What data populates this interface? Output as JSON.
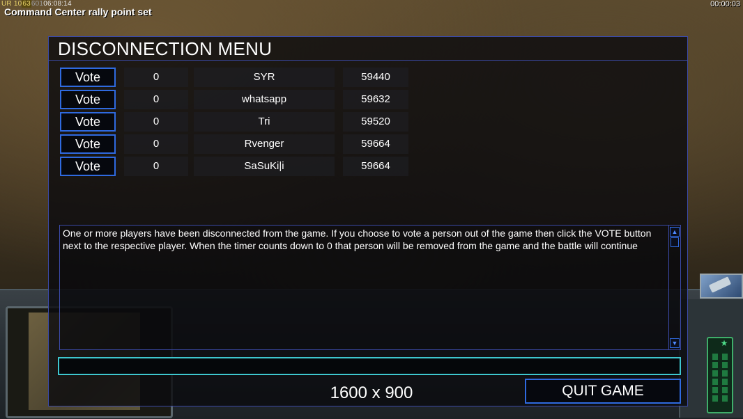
{
  "hud": {
    "stats_ur": "UR 10",
    "stats_63": "63",
    "stats_601": "601",
    "stats_time": "06:08:14",
    "notification": "Command Center rally point set",
    "game_timer": "00:00:03"
  },
  "dialog": {
    "title": "DISCONNECTION MENU",
    "vote_label": "Vote",
    "players": [
      {
        "count": "0",
        "name": "SYR",
        "id": "59440"
      },
      {
        "count": "0",
        "name": "whatsapp",
        "id": "59632"
      },
      {
        "count": "0",
        "name": "Tri",
        "id": "59520"
      },
      {
        "count": "0",
        "name": "Rvenger",
        "id": "59664"
      },
      {
        "count": "0",
        "name": "SaSuKi|i",
        "id": "59664"
      }
    ],
    "message": "One or more players have been disconnected from the game. If you choose to vote a person out of the game then click the VOTE button next to the respective player. When the timer counts down to 0 that person will be removed from the game and the battle will continue",
    "resolution": "1600 x 900",
    "quit_label": "QUIT GAME"
  },
  "icons": {
    "scroll_up": "scroll-up-arrow-icon",
    "scroll_down": "scroll-down-arrow-icon",
    "radar": "radar-star-icon"
  },
  "colors": {
    "dialog_border": "#3b4aa8",
    "button_border": "#2f6ae0",
    "input_border": "#3ec7cf",
    "radar_green": "#3fae6a"
  }
}
